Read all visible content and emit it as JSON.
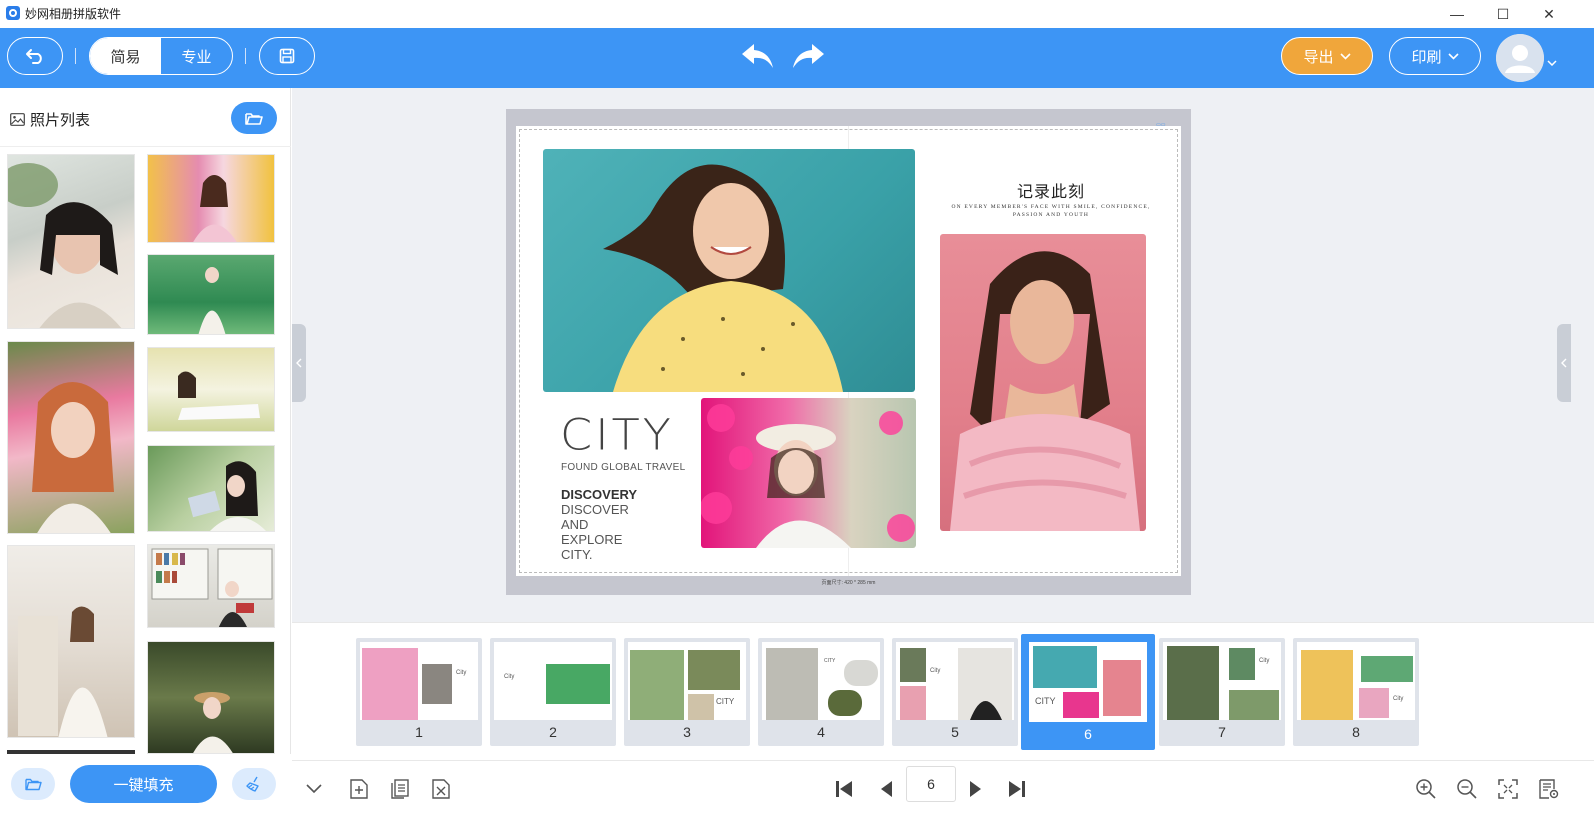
{
  "window": {
    "title": "妙网相册拼版软件",
    "controls": [
      "—",
      "☐",
      "✕"
    ]
  },
  "toolbar": {
    "mode_simple": "简易",
    "mode_pro": "专业",
    "export_label": "导出",
    "print_label": "印刷",
    "accent": "#3d95f5",
    "export_color": "#f0a63b"
  },
  "photo_list": {
    "title": "照片列表",
    "fill_button": "一键填充"
  },
  "spread": {
    "title_cn": "记录此刻",
    "tagline": "ON EVERY MEMBER'S FACE WITH SMILE, CONFIDENCE, PASSION AND YOUTH",
    "city": "CITY",
    "city_sub": "FOUND GLOBAL TRAVEL",
    "discovery": "DISCOVERY",
    "discover_text": "DISCOVER AND EXPLORE CITY.",
    "size_label": "页面尺寸: 420 * 285 mm"
  },
  "pages": [
    {
      "num": "1"
    },
    {
      "num": "2"
    },
    {
      "num": "3"
    },
    {
      "num": "4"
    },
    {
      "num": "5"
    },
    {
      "num": "6",
      "selected": true
    },
    {
      "num": "7"
    },
    {
      "num": "8"
    }
  ],
  "pager": {
    "current_page": "6"
  }
}
